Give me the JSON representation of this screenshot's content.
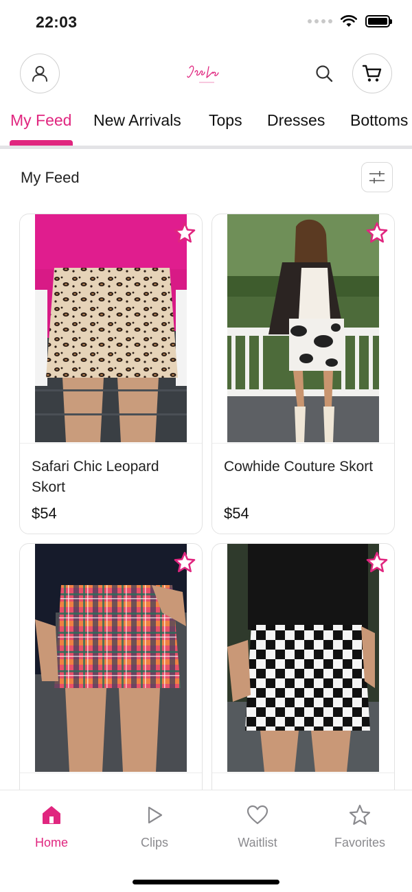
{
  "status": {
    "time": "22:03"
  },
  "header": {
    "logo_text": "Jess Lea",
    "logo_sub": "BOUTIQUE",
    "icons": {
      "account": "person-icon",
      "search": "search-icon",
      "cart": "cart-icon"
    }
  },
  "tabs": [
    {
      "label": "My Feed",
      "active": true
    },
    {
      "label": "New Arrivals"
    },
    {
      "label": "Tops"
    },
    {
      "label": "Dresses"
    },
    {
      "label": "Bottoms"
    }
  ],
  "section": {
    "title": "My Feed",
    "filter_icon": "sliders-icon"
  },
  "products": [
    {
      "name": "Safari Chic Leopard Skort",
      "price": "$54",
      "pattern": "leopard"
    },
    {
      "name": "Cowhide Couture Skort",
      "price": "$54",
      "pattern": "cowhide"
    },
    {
      "name": "",
      "price": "",
      "pattern": "plaid"
    },
    {
      "name": "",
      "price": "",
      "pattern": "checker"
    }
  ],
  "bottom_nav": [
    {
      "label": "Home",
      "icon": "home-icon",
      "active": true
    },
    {
      "label": "Clips",
      "icon": "play-icon"
    },
    {
      "label": "Waitlist",
      "icon": "heart-icon"
    },
    {
      "label": "Favorites",
      "icon": "star-icon"
    }
  ],
  "colors": {
    "accent": "#e0267f",
    "inactive": "#8a8a8e"
  }
}
